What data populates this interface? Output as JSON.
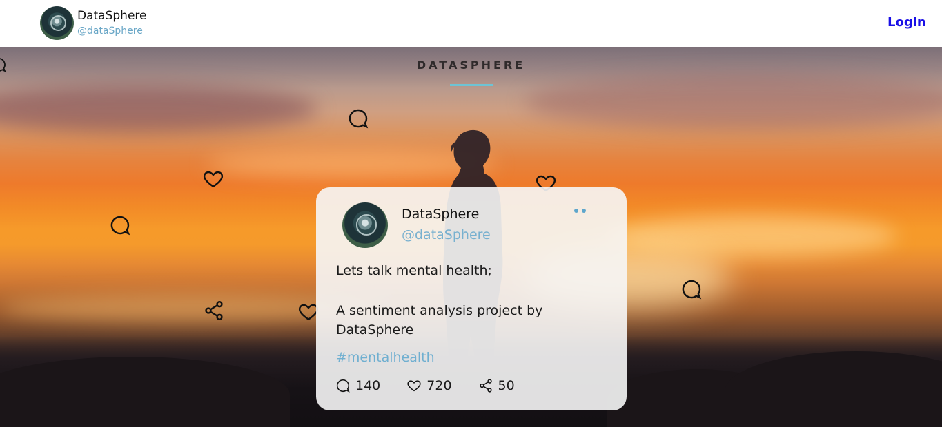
{
  "header": {
    "brand_name": "DataSphere",
    "brand_handle": "@dataSphere",
    "login_label": "Login"
  },
  "hero": {
    "title": "DATASPHERE",
    "accent_color": "#6ec3d4"
  },
  "post": {
    "author_name": "DataSphere",
    "author_handle": "@dataSphere",
    "line1": "Lets talk mental health;",
    "line2": "A sentiment analysis project by DataSphere",
    "hashtag": "#mentalhealth",
    "comments": "140",
    "likes": "720",
    "shares": "50"
  },
  "icons": {
    "comment": "comment-bubble-icon",
    "like": "heart-icon",
    "share": "share-icon",
    "more": "more-dots-icon"
  },
  "colors": {
    "login": "#1a10e6",
    "handle": "#6aa7c7",
    "hashtag": "#6fafd0"
  }
}
